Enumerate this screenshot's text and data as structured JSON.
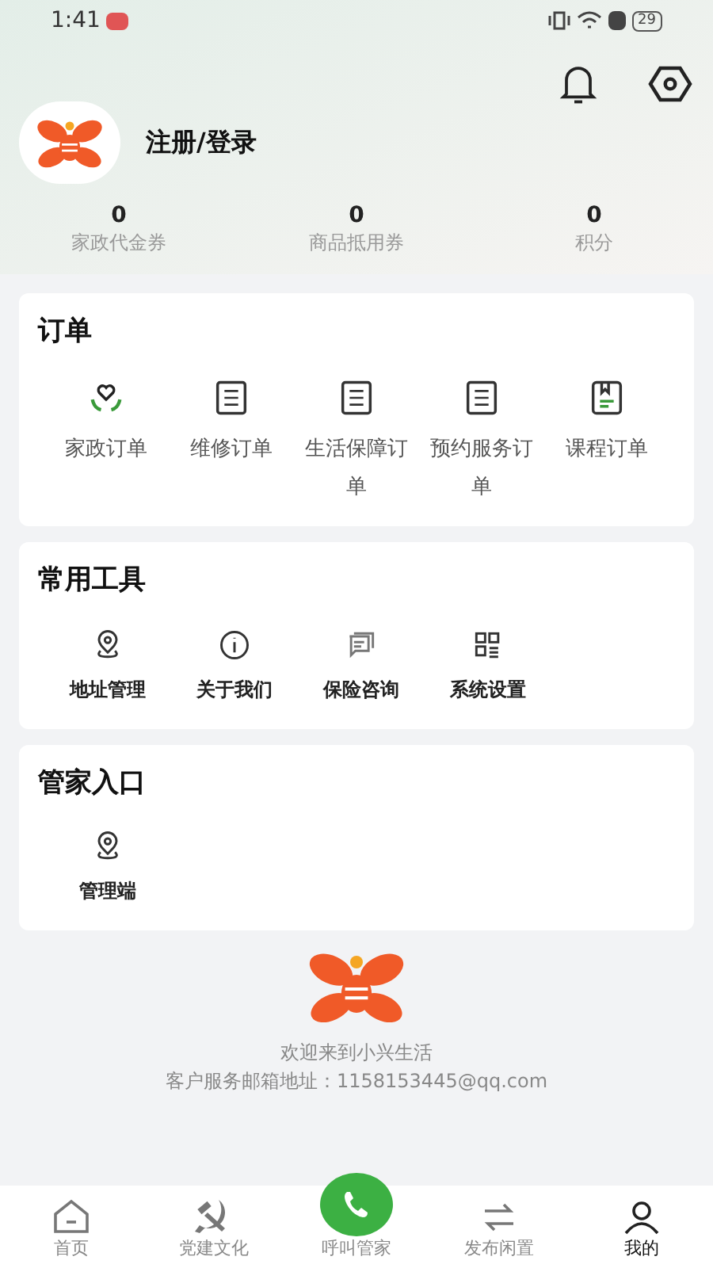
{
  "status_bar": {
    "time": "1:41",
    "battery": "29"
  },
  "header": {
    "login_label": "注册/登录",
    "stats": [
      {
        "value": "0",
        "label": "家政代金券"
      },
      {
        "value": "0",
        "label": "商品抵用券"
      },
      {
        "value": "0",
        "label": "积分"
      }
    ]
  },
  "sections": [
    {
      "title": "订单",
      "kind": "order",
      "items": [
        {
          "label": "家政订单",
          "kind": "heart"
        },
        {
          "label": "维修订单",
          "kind": "clipboard"
        },
        {
          "label": "生活保障订单",
          "kind": "clipboard"
        },
        {
          "label": "预约服务订单",
          "kind": "clipboard"
        },
        {
          "label": "课程订单",
          "kind": "book"
        }
      ]
    },
    {
      "title": "常用工具",
      "kind": "tool",
      "items": [
        {
          "label": "地址管理",
          "kind": "location"
        },
        {
          "label": "关于我们",
          "kind": "info"
        },
        {
          "label": "保险咨询",
          "kind": "chat"
        },
        {
          "label": "系统设置",
          "kind": "grid"
        }
      ]
    },
    {
      "title": "管家入口",
      "kind": "tool",
      "items": [
        {
          "label": "管理端",
          "kind": "location"
        }
      ]
    }
  ],
  "footer": {
    "welcome": "欢迎来到小兴生活",
    "email": "客户服务邮箱地址：1158153445@qq.com"
  },
  "tab_bar": [
    {
      "label": "首页",
      "kind": "home",
      "selected": false
    },
    {
      "label": "党建文化",
      "kind": "emblem",
      "selected": false
    },
    {
      "label": "呼叫管家",
      "kind": "phone",
      "selected": false
    },
    {
      "label": "发布闲置",
      "kind": "swap",
      "selected": false
    },
    {
      "label": "我的",
      "kind": "user",
      "selected": true
    }
  ]
}
